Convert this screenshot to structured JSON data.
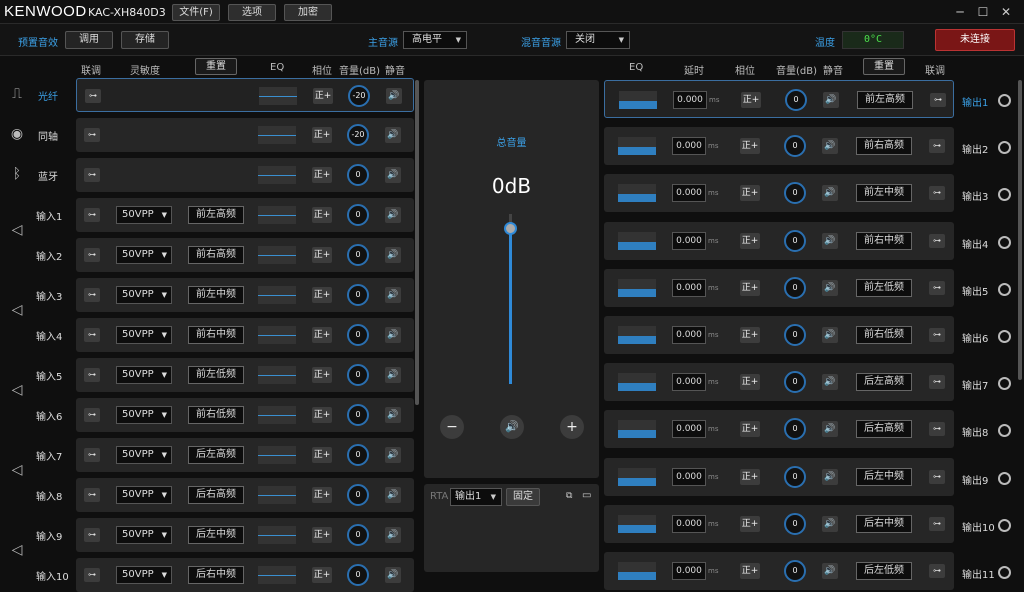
{
  "app": {
    "brand": "KENWOOD",
    "model": "KAC-XH840D3"
  },
  "menu": {
    "file": "文件(F)",
    "options": "选项",
    "encrypt": "加密"
  },
  "window": {
    "min": "─",
    "max": "☐",
    "close": "✕"
  },
  "toolbar": {
    "preset_label": "预置音效",
    "recall": "调用",
    "store": "存储",
    "main_source_label": "主音源",
    "main_source_value": "高电平",
    "mix_source_label": "混音音源",
    "mix_source_value": "关闭",
    "temp_label": "温度",
    "temp_value": "0°C",
    "connect": "未连接"
  },
  "left_header": {
    "link": "联调",
    "sensitivity": "灵敏度",
    "reset": "重置",
    "eq": "EQ",
    "phase": "相位",
    "volume": "音量(dB)",
    "mute": "静音"
  },
  "right_header": {
    "eq": "EQ",
    "delay": "延时",
    "phase": "相位",
    "volume": "音量(dB)",
    "mute": "静音",
    "reset": "重置",
    "link": "联调"
  },
  "inputs": [
    {
      "label": "光纤",
      "sens": "",
      "name": "",
      "phase": "正+",
      "vol": "-20"
    },
    {
      "label": "同轴",
      "sens": "",
      "name": "",
      "phase": "正+",
      "vol": "-20"
    },
    {
      "label": "蓝牙",
      "sens": "",
      "name": "",
      "phase": "正+",
      "vol": "0"
    },
    {
      "label": "输入1",
      "sens": "50VPP",
      "name": "前左高频",
      "phase": "正+",
      "vol": "0"
    },
    {
      "label": "输入2",
      "sens": "50VPP",
      "name": "前右高频",
      "phase": "正+",
      "vol": "0"
    },
    {
      "label": "输入3",
      "sens": "50VPP",
      "name": "前左中频",
      "phase": "正+",
      "vol": "0"
    },
    {
      "label": "输入4",
      "sens": "50VPP",
      "name": "前右中频",
      "phase": "正+",
      "vol": "0"
    },
    {
      "label": "输入5",
      "sens": "50VPP",
      "name": "前左低频",
      "phase": "正+",
      "vol": "0"
    },
    {
      "label": "输入6",
      "sens": "50VPP",
      "name": "前右低频",
      "phase": "正+",
      "vol": "0"
    },
    {
      "label": "输入7",
      "sens": "50VPP",
      "name": "后左高频",
      "phase": "正+",
      "vol": "0"
    },
    {
      "label": "输入8",
      "sens": "50VPP",
      "name": "后右高频",
      "phase": "正+",
      "vol": "0"
    },
    {
      "label": "输入9",
      "sens": "50VPP",
      "name": "后左中频",
      "phase": "正+",
      "vol": "0"
    },
    {
      "label": "输入10",
      "sens": "50VPP",
      "name": "后右中频",
      "phase": "正+",
      "vol": "0"
    }
  ],
  "master": {
    "label": "总音量",
    "value": "0dB",
    "level": 1.0,
    "minus": "−",
    "plus": "+"
  },
  "rta": {
    "label": "RTA",
    "select": "输出1",
    "fix": "固定"
  },
  "outputs": [
    {
      "label": "输出1",
      "delay": "0.000",
      "unit": "ms",
      "phase": "正+",
      "vol": "0",
      "name": "前左高频"
    },
    {
      "label": "输出2",
      "delay": "0.000",
      "unit": "ms",
      "phase": "正+",
      "vol": "0",
      "name": "前右高频"
    },
    {
      "label": "输出3",
      "delay": "0.000",
      "unit": "ms",
      "phase": "正+",
      "vol": "0",
      "name": "前左中频"
    },
    {
      "label": "输出4",
      "delay": "0.000",
      "unit": "ms",
      "phase": "正+",
      "vol": "0",
      "name": "前右中频"
    },
    {
      "label": "输出5",
      "delay": "0.000",
      "unit": "ms",
      "phase": "正+",
      "vol": "0",
      "name": "前左低频"
    },
    {
      "label": "输出6",
      "delay": "0.000",
      "unit": "ms",
      "phase": "正+",
      "vol": "0",
      "name": "前右低频"
    },
    {
      "label": "输出7",
      "delay": "0.000",
      "unit": "ms",
      "phase": "正+",
      "vol": "0",
      "name": "后左高频"
    },
    {
      "label": "输出8",
      "delay": "0.000",
      "unit": "ms",
      "phase": "正+",
      "vol": "0",
      "name": "后右高频"
    },
    {
      "label": "输出9",
      "delay": "0.000",
      "unit": "ms",
      "phase": "正+",
      "vol": "0",
      "name": "后左中频"
    },
    {
      "label": "输出10",
      "delay": "0.000",
      "unit": "ms",
      "phase": "正+",
      "vol": "0",
      "name": "后右中频"
    },
    {
      "label": "输出11",
      "delay": "0.000",
      "unit": "ms",
      "phase": "正+",
      "vol": "0",
      "name": "后左低频"
    }
  ],
  "colors": {
    "accent": "#3ba0e6",
    "connect_bg": "#7a1616",
    "temp_text": "#4ce04c"
  }
}
